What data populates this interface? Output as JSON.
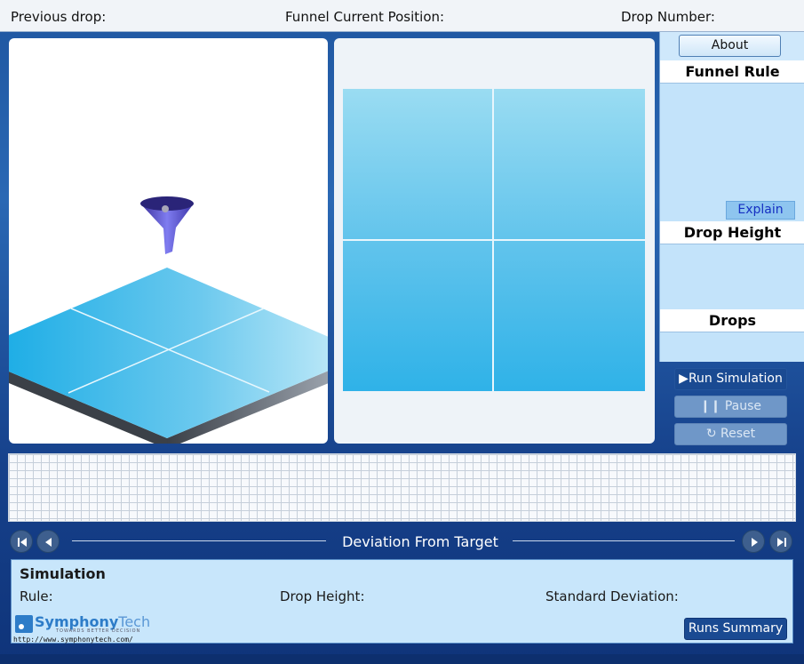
{
  "topbar": {
    "previous_drop": "Previous drop:",
    "funnel_position": "Funnel Current Position:",
    "drop_number": "Drop Number:"
  },
  "side": {
    "about": "About",
    "funnel_rule": "Funnel Rule",
    "explain": "Explain",
    "drop_height": "Drop Height",
    "drops": "Drops"
  },
  "controls": {
    "run": "Run Simulation",
    "pause": "Pause",
    "reset": "Reset"
  },
  "nav": {
    "title": "Deviation From Target"
  },
  "summary": {
    "title": "Simulation",
    "rule": "Rule:",
    "drop_height": "Drop Height:",
    "std_dev": "Standard Deviation:",
    "runs_summary": "Runs Summary"
  },
  "logo": {
    "name_a": "Symphony",
    "name_b": "Tech",
    "tagline": "TOWARDS BETTER DECISION",
    "url": "http://www.symphonytech.com/"
  },
  "colors": {
    "accent": "#1a4a92",
    "panel": "#c3e3fa",
    "target": "#2fb2e8"
  }
}
